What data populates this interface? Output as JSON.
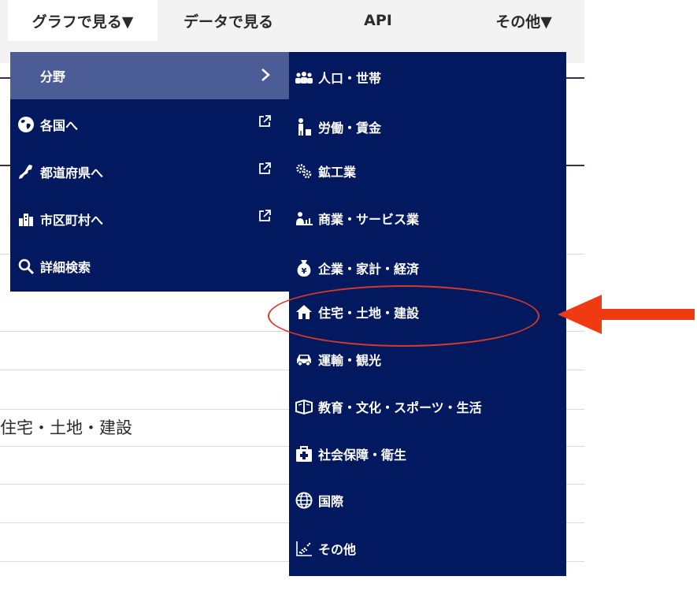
{
  "nav": {
    "graph": "グラフで見る▼",
    "data": "データで見る",
    "api": "API",
    "other": "その他▼"
  },
  "left_menu": {
    "items": [
      {
        "label": "分野",
        "icon": "chevron-right-icon",
        "selected": true
      },
      {
        "label": "各国へ",
        "icon": "globe-icon",
        "external": true
      },
      {
        "label": "都道府県へ",
        "icon": "prefecture-map-icon",
        "external": true
      },
      {
        "label": "市区町村へ",
        "icon": "city-buildings-icon",
        "external": true
      },
      {
        "label": "詳細検索",
        "icon": "search-icon"
      }
    ]
  },
  "right_menu": {
    "items": [
      {
        "label": "人口・世帯",
        "icon": "people-icon"
      },
      {
        "label": "労働・賃金",
        "icon": "worker-icon"
      },
      {
        "label": "鉱工業",
        "icon": "gears-icon"
      },
      {
        "label": "商業・サービス業",
        "icon": "shop-person-icon"
      },
      {
        "label": "企業・家計・経済",
        "icon": "yen-bag-icon"
      },
      {
        "label": "住宅・土地・建設",
        "icon": "house-icon"
      },
      {
        "label": "運輸・観光",
        "icon": "car-icon"
      },
      {
        "label": "教育・文化・スポーツ・生活",
        "icon": "books-icon"
      },
      {
        "label": "社会保障・衛生",
        "icon": "medical-kit-icon"
      },
      {
        "label": "国際",
        "icon": "world-globe-icon"
      },
      {
        "label": "その他",
        "icon": "scatter-chart-icon"
      }
    ]
  },
  "background": {
    "heading": "住宅・土地・建設"
  },
  "colors": {
    "menu_bg": "#03195f",
    "menu_selected": "#4b5c97",
    "annotation": "#d33a2c",
    "arrow": "#f03a12"
  }
}
